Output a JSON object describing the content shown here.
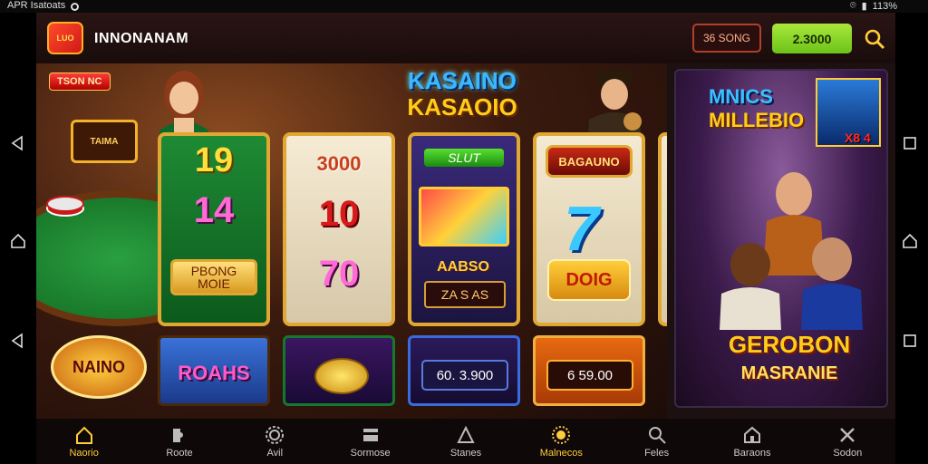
{
  "status_bar": {
    "left_text": "APR Isatoats",
    "right_text": "113%"
  },
  "header": {
    "logo_text": "LUO",
    "app_name": "INNONANAM",
    "coins_label": "36 SONG",
    "balance": "2.3000"
  },
  "banner": {
    "corner_tag": "TSON NC",
    "sign_text": "TAIMA",
    "title_line1": "KASAINO",
    "title_line2": "KASAOIO",
    "reels": {
      "reel1": {
        "top": "19",
        "middle": "14",
        "bottom_badge": "PBONG MOIE"
      },
      "reel2": {
        "top": "3000",
        "middle": "10",
        "bottom": "70"
      },
      "reel3": {
        "label": "SLUT",
        "tag": "AABSO",
        "box": "ZA S AS"
      },
      "reel4": {
        "top_badge": "BAGAUNO",
        "seven": "7",
        "bottom_badge": "DOIG"
      }
    },
    "lower_tiles": {
      "tile1_text": "ROAHS",
      "tile3_amount": "60. 3.900",
      "tile4_amount": "6 59.00"
    },
    "casino_logo": "NAINO"
  },
  "promo": {
    "title_line1": "MNICS",
    "title_line2": "MILLEBIO",
    "tag": "X8 4",
    "bottom_line1": "GEROBON",
    "bottom_line2": "MASRANIE"
  },
  "bottom_nav": [
    {
      "label": "Naorio",
      "icon": "home-icon"
    },
    {
      "label": "Roote",
      "icon": "puzzle-icon"
    },
    {
      "label": "Avil",
      "icon": "gear-icon"
    },
    {
      "label": "Sormose",
      "icon": "card-icon"
    },
    {
      "label": "Stanes",
      "icon": "triangle-icon"
    },
    {
      "label": "Malnecos",
      "icon": "sun-icon"
    },
    {
      "label": "Feles",
      "icon": "search-icon"
    },
    {
      "label": "Baraons",
      "icon": "house-icon"
    },
    {
      "label": "Sodon",
      "icon": "tools-icon"
    }
  ],
  "colors": {
    "accent_gold": "#ffcc3a",
    "balance_green": "#8ad82a",
    "header_bg": "#1a0c0c"
  }
}
